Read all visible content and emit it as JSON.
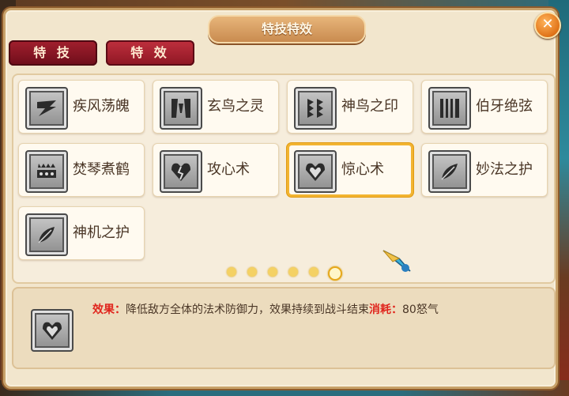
{
  "window": {
    "title": "特技特效"
  },
  "tabs": [
    {
      "label": "特 技"
    },
    {
      "label": "特 效"
    }
  ],
  "skills": [
    {
      "name": "疾风荡魄",
      "icon": "wind-blade-icon"
    },
    {
      "name": "玄鸟之灵",
      "icon": "mystic-bird-icon"
    },
    {
      "name": "神鸟之印",
      "icon": "divine-bird-seal-icon"
    },
    {
      "name": "伯牙绝弦",
      "icon": "zither-strings-icon"
    },
    {
      "name": "焚琴煮鹤",
      "icon": "burning-zither-icon"
    },
    {
      "name": "攻心术",
      "icon": "broken-heart-icon"
    },
    {
      "name": "惊心术",
      "icon": "heart-shock-icon",
      "selected": true
    },
    {
      "name": "妙法之护",
      "icon": "feather-shield-icon"
    },
    {
      "name": "神机之护",
      "icon": "feather-guard-icon"
    }
  ],
  "pagination": {
    "pages": 6,
    "current": 6
  },
  "description": {
    "effect_label": "效果：",
    "effect_text": "降低敌方全体的法术防御力，效果持续到战斗结束",
    "cost_label": "消耗：",
    "cost_value": "80怒气"
  },
  "colors": {
    "accent_red": "#e0261e",
    "tab_red": "#a3202e",
    "selected_border": "#f2b431"
  }
}
